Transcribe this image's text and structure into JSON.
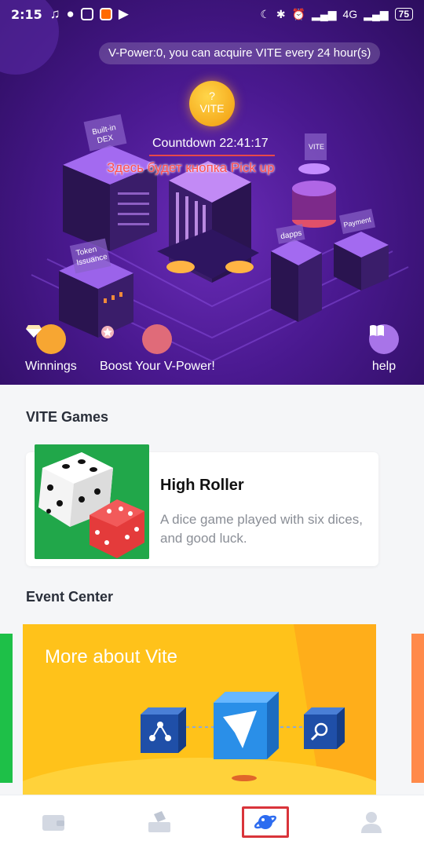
{
  "status_bar": {
    "time": "2:15",
    "network": "4G",
    "battery": "75"
  },
  "hero": {
    "v_power_text": "V-Power:0, you can acquire VITE every 24 hour(s)",
    "coin_question": "?",
    "coin_label": "VITE",
    "countdown": "Countdown 22:41:17",
    "annotation": "Здесь будет кнопка Pick up",
    "building_labels": [
      "Built-in DEX",
      "Token Issuance",
      "dapps",
      "Payment",
      "VITE"
    ],
    "buttons": [
      {
        "label": "Winnings",
        "icon": "diamond-icon"
      },
      {
        "label": "Boost Your V-Power!",
        "icon": "star-badge-icon"
      },
      {
        "label": "help",
        "icon": "book-icon"
      }
    ]
  },
  "games": {
    "section_title": "VITE Games",
    "items": [
      {
        "title": "High Roller",
        "description": "A dice game played with six dices, and good luck."
      }
    ]
  },
  "events": {
    "section_title": "Event Center",
    "banner_title": "More about Vite"
  },
  "nav": {
    "items": [
      {
        "icon": "wallet-icon",
        "active": false
      },
      {
        "icon": "vote-box-icon",
        "active": false
      },
      {
        "icon": "planet-icon",
        "active": true
      },
      {
        "icon": "profile-icon",
        "active": false
      }
    ]
  },
  "colors": {
    "hero_bg": "#4a1990",
    "accent_orange": "#f7a632",
    "active_nav_blue": "#2d6cf0",
    "annotation_red": "#ff4d4f",
    "event_yellow": "#ffc21a"
  }
}
